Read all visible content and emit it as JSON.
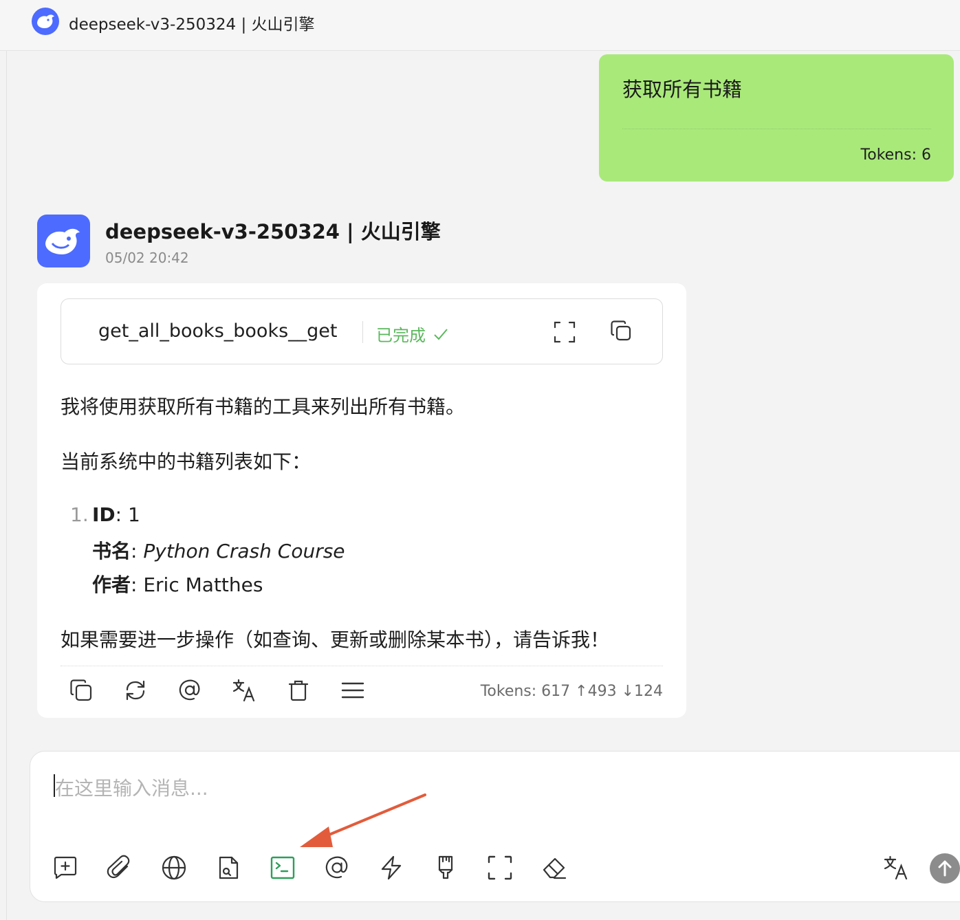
{
  "header": {
    "title": "deepseek-v3-250324 | 火山引擎"
  },
  "user_message": {
    "text": "获取所有书籍",
    "tokens": "Tokens: 6"
  },
  "assistant": {
    "name": "deepseek-v3-250324 | 火山引擎",
    "time": "05/02 20:42",
    "tool_call": {
      "name": "get_all_books_books__get",
      "status": "已完成"
    },
    "intro": "我将使用获取所有书籍的工具来列出所有书籍。",
    "list_intro": "当前系统中的书籍列表如下：",
    "books": [
      {
        "num": "1.",
        "id_label": "ID",
        "id_value": ": 1",
        "title_label": "书名",
        "title_value": "Python Crash Course",
        "author_label": "作者",
        "author_value": ": Eric Matthes"
      }
    ],
    "outro": "如果需要进一步操作（如查询、更新或删除某本书），请告诉我！",
    "tokens": "Tokens: 617 ↑493 ↓124"
  },
  "composer": {
    "placeholder": "在这里输入消息..."
  },
  "colors": {
    "brand": "#4d6bfe",
    "user_bubble": "#a9e97a",
    "success": "#5bb85d",
    "active_tool": "#2e9e5b",
    "annotation_arrow": "#e25c3b"
  },
  "icons": {
    "message_actions": [
      "copy-icon",
      "regenerate-icon",
      "mention-icon",
      "translate-icon",
      "delete-icon",
      "menu-icon"
    ],
    "composer_tools": [
      "new-topic-icon",
      "attachment-icon",
      "web-search-icon",
      "knowledge-base-icon",
      "mcp-terminal-icon",
      "mention-icon",
      "quick-phrase-icon",
      "clear-style-icon",
      "expand-icon",
      "eraser-icon"
    ]
  }
}
